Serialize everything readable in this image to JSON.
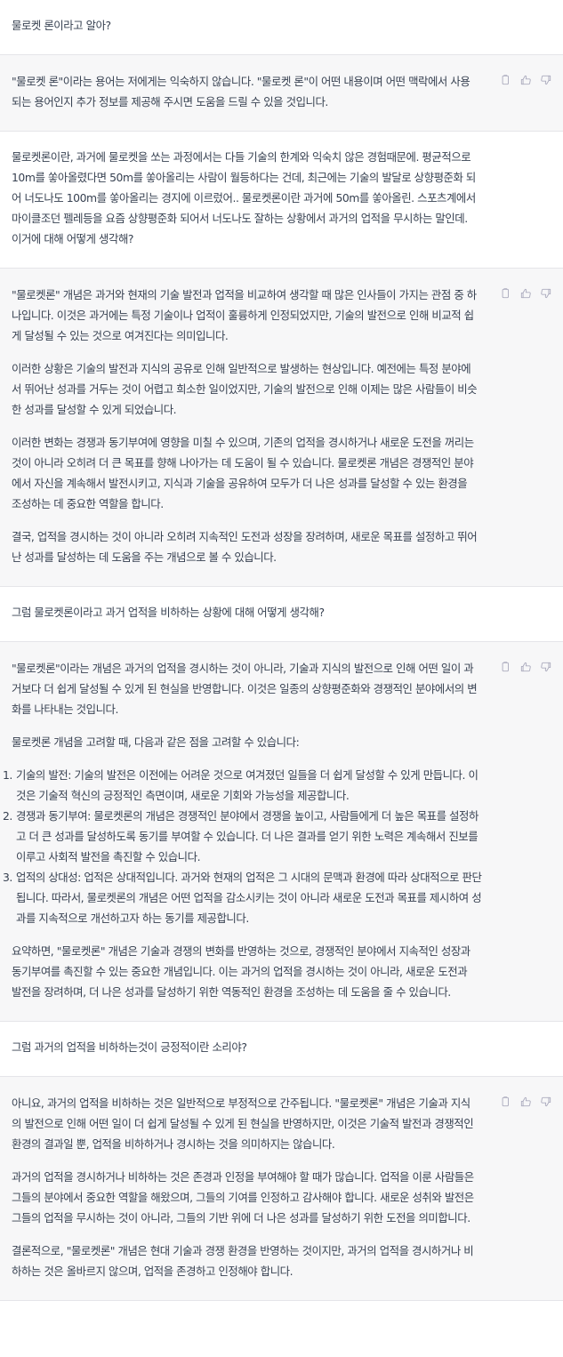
{
  "colors": {
    "user_bg": "#ffffff",
    "assistant_bg": "#f7f7f8",
    "text": "#374151",
    "icon": "#acacbe",
    "divider": "#e5e5e9"
  },
  "action_icons": [
    "clipboard-icon",
    "thumbs-up-icon",
    "thumbs-down-icon"
  ],
  "messages": [
    {
      "role": "user",
      "text": "물로켓 론이라고 알아?"
    },
    {
      "role": "assistant",
      "paragraphs": [
        "\"물로켓 론\"이라는 용어는 저에게는 익숙하지 않습니다. \"물로켓 론\"이 어떤 내용이며 어떤 맥락에서 사용되는 용어인지 추가 정보를 제공해 주시면 도움을 드릴 수 있을 것입니다."
      ]
    },
    {
      "role": "user",
      "text": "물로켓론이란, 과거에 물로켓을 쏘는 과정에서는 다들 기술의 한계와 익숙치 않은 경험때문에. 평균적으로 10m를 쏳아올렸다면 50m를 쏳아올리는 사람이 월등하다는 건데, 최근에는 기술의 발달로 상향평준화 되어 너도나도 100m를 쏳아올리는 경지에 이르렀어.. 물로켓론이란 과거에 50m를 쏳아올린. 스포츠계에서 마이클조던 펠레등을 요즘 상향평준화 되어서 너도나도 잘하는 상황에서 과거의 업적을 무시하는 말인데. 이거에 대해 어떻게 생각해?"
    },
    {
      "role": "assistant",
      "paragraphs": [
        "\"물로켓론\" 개념은 과거와 현재의 기술 발전과 업적을 비교하여 생각할 때 많은 인사들이 가지는 관점 중 하나입니다. 이것은 과거에는 특정 기술이나 업적이 훌륭하게 인정되었지만, 기술의 발전으로 인해 비교적 쉽게 달성될 수 있는 것으로 여겨진다는 의미입니다.",
        "이러한 상황은 기술의 발전과 지식의 공유로 인해 일반적으로 발생하는 현상입니다. 예전에는 특정 분야에서 뛰어난 성과를 거두는 것이 어렵고 희소한 일이었지만, 기술의 발전으로 인해 이제는 많은 사람들이 비슷한 성과를 달성할 수 있게 되었습니다.",
        "이러한 변화는 경쟁과 동기부여에 영향을 미칠 수 있으며, 기존의 업적을 경시하거나 새로운 도전을 꺼리는 것이 아니라 오히려 더 큰 목표를 향해 나아가는 데 도움이 될 수 있습니다. 물로켓론 개념은 경쟁적인 분야에서 자신을 계속해서 발전시키고, 지식과 기술을 공유하여 모두가 더 나은 성과를 달성할 수 있는 환경을 조성하는 데 중요한 역할을 합니다.",
        "결국, 업적을 경시하는 것이 아니라 오히려 지속적인 도전과 성장을 장려하며, 새로운 목표를 설정하고 뛰어난 성과를 달성하는 데 도움을 주는 개념으로 볼 수 있습니다."
      ]
    },
    {
      "role": "user",
      "text": "그럼 물로켓론이라고 과거 업적을 비하하는 상황에 대해 어떻게 생각해?"
    },
    {
      "role": "assistant",
      "intro": [
        "\"물로켓론\"이라는 개념은 과거의 업적을 경시하는 것이 아니라, 기술과 지식의 발전으로 인해 어떤 일이 과거보다 더 쉽게 달성될 수 있게 된 현실을 반영합니다. 이것은 일종의 상향평준화와 경쟁적인 분야에서의 변화를 나타내는 것입니다.",
        "물로켓론 개념을 고려할 때, 다음과 같은 점을 고려할 수 있습니다:"
      ],
      "list": [
        {
          "num": "1.",
          "text": "기술의 발전: 기술의 발전은 이전에는 어려운 것으로 여겨졌던 일들을 더 쉽게 달성할 수 있게 만듭니다. 이것은 기술적 혁신의 긍정적인 측면이며, 새로운 기회와 가능성을 제공합니다."
        },
        {
          "num": "2.",
          "text": "경쟁과 동기부여: 물로켓론의 개념은 경쟁적인 분야에서 경쟁을 높이고, 사람들에게 더 높은 목표를 설정하고 더 큰 성과를 달성하도록 동기를 부여할 수 있습니다. 더 나은 결과를 얻기 위한 노력은 계속해서 진보를 이루고 사회적 발전을 촉진할 수 있습니다."
        },
        {
          "num": "3.",
          "text": "업적의 상대성: 업적은 상대적입니다. 과거와 현재의 업적은 그 시대의 문맥과 환경에 따라 상대적으로 판단됩니다. 따라서, 물로켓론의 개념은 어떤 업적을 감소시키는 것이 아니라 새로운 도전과 목표를 제시하여 성과를 지속적으로 개선하고자 하는 동기를 제공합니다."
        }
      ],
      "outro": [
        "요약하면, \"물로켓론\" 개념은 기술과 경쟁의 변화를 반영하는 것으로, 경쟁적인 분야에서 지속적인 성장과 동기부여를 촉진할 수 있는 중요한 개념입니다. 이는 과거의 업적을 경시하는 것이 아니라, 새로운 도전과 발전을 장려하며, 더 나은 성과를 달성하기 위한 역동적인 환경을 조성하는 데 도움을 줄 수 있습니다."
      ]
    },
    {
      "role": "user",
      "text": "그럼 과거의 업적을 비하하는것이 긍정적이란 소리야?"
    },
    {
      "role": "assistant",
      "paragraphs": [
        "아니요, 과거의 업적을 비하하는 것은 일반적으로 부정적으로 간주됩니다. \"물로켓론\" 개념은 기술과 지식의 발전으로 인해 어떤 일이 더 쉽게 달성될 수 있게 된 현실을 반영하지만, 이것은 기술적 발전과 경쟁적인 환경의 결과일 뿐, 업적을 비하하거나 경시하는 것을 의미하지는 않습니다.",
        "과거의 업적을 경시하거나 비하하는 것은 존경과 인정을 부여해야 할 때가 많습니다. 업적을 이룬 사람들은 그들의 분야에서 중요한 역할을 해왔으며, 그들의 기여를 인정하고 감사해야 합니다. 새로운 성취와 발전은 그들의 업적을 무시하는 것이 아니라, 그들의 기반 위에 더 나은 성과를 달성하기 위한 도전을 의미합니다.",
        "결론적으로, \"물로켓론\" 개념은 현대 기술과 경쟁 환경을 반영하는 것이지만, 과거의 업적을 경시하거나 비하하는 것은 올바르지 않으며, 업적을 존경하고 인정해야 합니다."
      ]
    }
  ]
}
